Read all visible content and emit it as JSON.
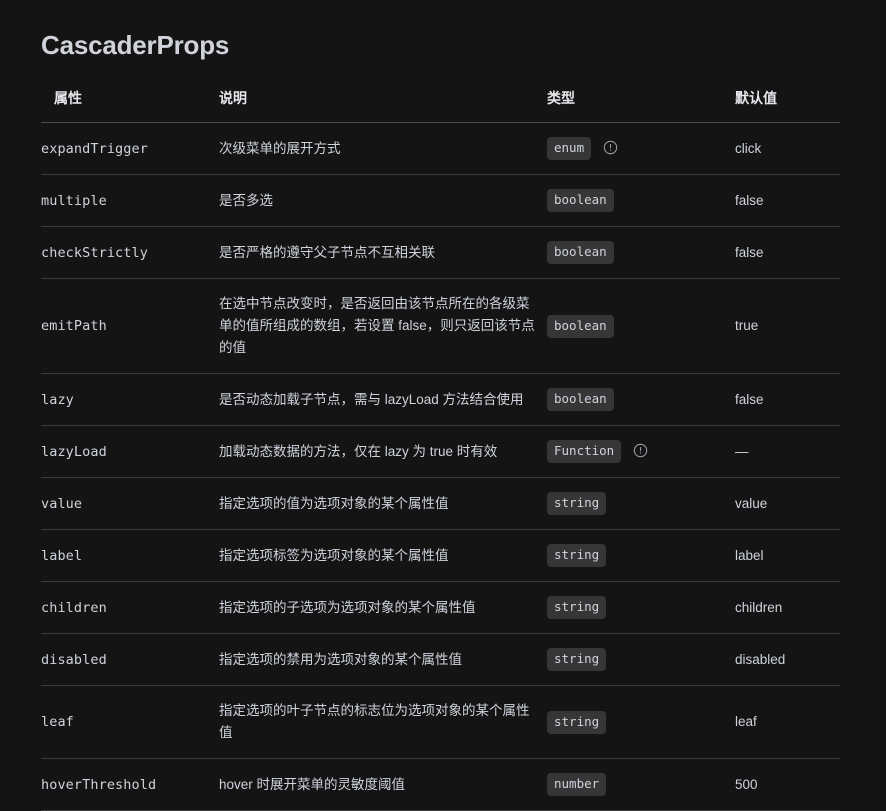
{
  "page": {
    "title": "CascaderProps",
    "background_color": "#141414",
    "text_color": "#cfd3dc",
    "badge_color": "#363637",
    "border_color": "#3b3b3b",
    "header_border_color": "#4b4b4b"
  },
  "table": {
    "headers": {
      "property": "属性",
      "description": "说明",
      "type": "类型",
      "default": "默认值"
    },
    "rows": [
      {
        "property": "expandTrigger",
        "description": "次级菜单的展开方式",
        "type": "enum",
        "has_info_icon": true,
        "default": "click"
      },
      {
        "property": "multiple",
        "description": "是否多选",
        "type": "boolean",
        "has_info_icon": false,
        "default": "false"
      },
      {
        "property": "checkStrictly",
        "description": "是否严格的遵守父子节点不互相关联",
        "type": "boolean",
        "has_info_icon": false,
        "default": "false"
      },
      {
        "property": "emitPath",
        "description": "在选中节点改变时，是否返回由该节点所在的各级菜单的值所组成的数组，若设置 false，则只返回该节点的值",
        "type": "boolean",
        "has_info_icon": false,
        "default": "true"
      },
      {
        "property": "lazy",
        "description": "是否动态加载子节点，需与 lazyLoad 方法结合使用",
        "type": "boolean",
        "has_info_icon": false,
        "default": "false"
      },
      {
        "property": "lazyLoad",
        "description": "加载动态数据的方法，仅在 lazy 为 true 时有效",
        "type": "Function",
        "has_info_icon": true,
        "default": "—"
      },
      {
        "property": "value",
        "description": "指定选项的值为选项对象的某个属性值",
        "type": "string",
        "has_info_icon": false,
        "default": "value"
      },
      {
        "property": "label",
        "description": "指定选项标签为选项对象的某个属性值",
        "type": "string",
        "has_info_icon": false,
        "default": "label"
      },
      {
        "property": "children",
        "description": "指定选项的子选项为选项对象的某个属性值",
        "type": "string",
        "has_info_icon": false,
        "default": "children"
      },
      {
        "property": "disabled",
        "description": "指定选项的禁用为选项对象的某个属性值",
        "type": "string",
        "has_info_icon": false,
        "default": "disabled"
      },
      {
        "property": "leaf",
        "description": "指定选项的叶子节点的标志位为选项对象的某个属性值",
        "type": "string",
        "has_info_icon": false,
        "default": "leaf"
      },
      {
        "property": "hoverThreshold",
        "description": "hover 时展开菜单的灵敏度阈值",
        "type": "number",
        "has_info_icon": false,
        "default": "500"
      }
    ]
  },
  "icons": {
    "info": "warning-circle-icon"
  }
}
